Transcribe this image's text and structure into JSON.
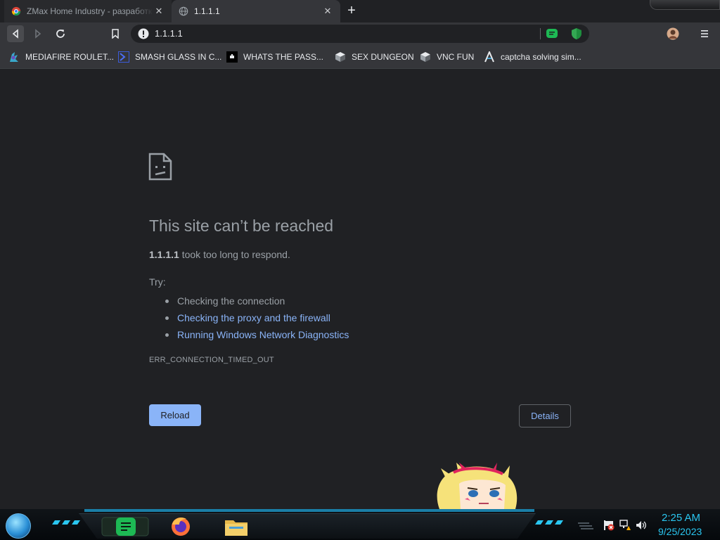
{
  "tabs": [
    {
      "title": "ZMax Home Industry - разработк",
      "active": false
    },
    {
      "title": "1.1.1.1",
      "active": true
    }
  ],
  "omnibox": {
    "url": "1.1.1.1"
  },
  "bookmarks": [
    {
      "label": "MEDIAFIRE ROULET..."
    },
    {
      "label": "SMASH GLASS IN C..."
    },
    {
      "label": "WHATS THE PASS..."
    },
    {
      "label": "SEX DUNGEON"
    },
    {
      "label": "VNC FUN"
    },
    {
      "label": "captcha solving sim..."
    }
  ],
  "error": {
    "title": "This site can’t be reached",
    "host": "1.1.1.1",
    "desc_suffix": " took too long to respond.",
    "try_label": "Try:",
    "suggestions": [
      {
        "text": "Checking the connection",
        "link": false
      },
      {
        "text": "Checking the proxy and the firewall",
        "link": true
      },
      {
        "text": "Running Windows Network Diagnostics",
        "link": true
      }
    ],
    "code": "ERR_CONNECTION_TIMED_OUT",
    "reload_label": "Reload",
    "details_label": "Details"
  },
  "taskbar": {
    "time": "2:25 AM",
    "date": "9/25/2023"
  },
  "colors": {
    "page_bg": "#202124",
    "toolbar_bg": "#35363a",
    "link": "#8ab4f8",
    "muted_text": "#9aa0a6",
    "clock": "#2ac6f0"
  }
}
